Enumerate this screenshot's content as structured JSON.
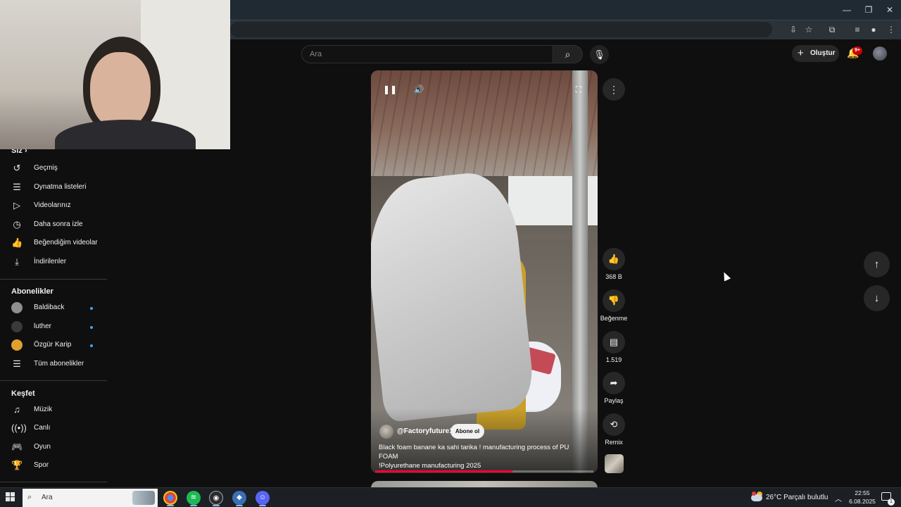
{
  "browser": {
    "window_controls": {
      "minimize": "—",
      "restore": "❐",
      "close": "✕"
    }
  },
  "header": {
    "search_placeholder": "Ara",
    "create_label": "Oluştur",
    "notification_badge": "9+"
  },
  "sidebar": {
    "you_title": "Siz",
    "you_items": [
      {
        "label": "Geçmiş",
        "icon": "history-icon"
      },
      {
        "label": "Oynatma listeleri",
        "icon": "playlist-icon"
      },
      {
        "label": "Videolarınız",
        "icon": "your-videos-icon"
      },
      {
        "label": "Daha sonra izle",
        "icon": "watch-later-icon"
      },
      {
        "label": "Beğendiğim videolar",
        "icon": "thumbs-up-icon"
      },
      {
        "label": "İndirilenler",
        "icon": "download-icon"
      }
    ],
    "subscriptions_title": "Abonelikler",
    "subscriptions": [
      {
        "label": "Baldiback",
        "avatar_color": "#8d8f91"
      },
      {
        "label": "luther",
        "avatar_color": "#3a3a3a"
      },
      {
        "label": "Özgür Karip",
        "avatar_color": "#e0a030"
      }
    ],
    "all_subscriptions": "Tüm abonelikler",
    "explore_title": "Keşfet",
    "explore_items": [
      {
        "label": "Müzik",
        "icon": "music-icon"
      },
      {
        "label": "Canlı",
        "icon": "live-icon"
      },
      {
        "label": "Oyun",
        "icon": "gaming-icon"
      },
      {
        "label": "Spor",
        "icon": "trophy-icon"
      }
    ]
  },
  "short": {
    "channel": "@Factoryfuture1",
    "subscribe_label": "Abone ol",
    "title_line1": "Black foam banane ka sahi tarika ! manufacturing process of PU FOAM",
    "title_line2": "!Polyurethane manufacturing 2025",
    "progress": 0.63,
    "actions": {
      "likes": "368 B",
      "dislike_label": "Beğenme",
      "comments": "1.519",
      "share_label": "Paylaş",
      "remix_label": "Remix"
    }
  },
  "taskbar": {
    "search_placeholder": "Ara",
    "weather": "26°C  Parçalı bulutlu",
    "time": "22:55",
    "date": "6.08.2025",
    "notifications": "1"
  },
  "colors": {
    "background": "#0f0f0f",
    "accent_red": "#ff0033",
    "subscription_dot": "#3ea6ff"
  }
}
